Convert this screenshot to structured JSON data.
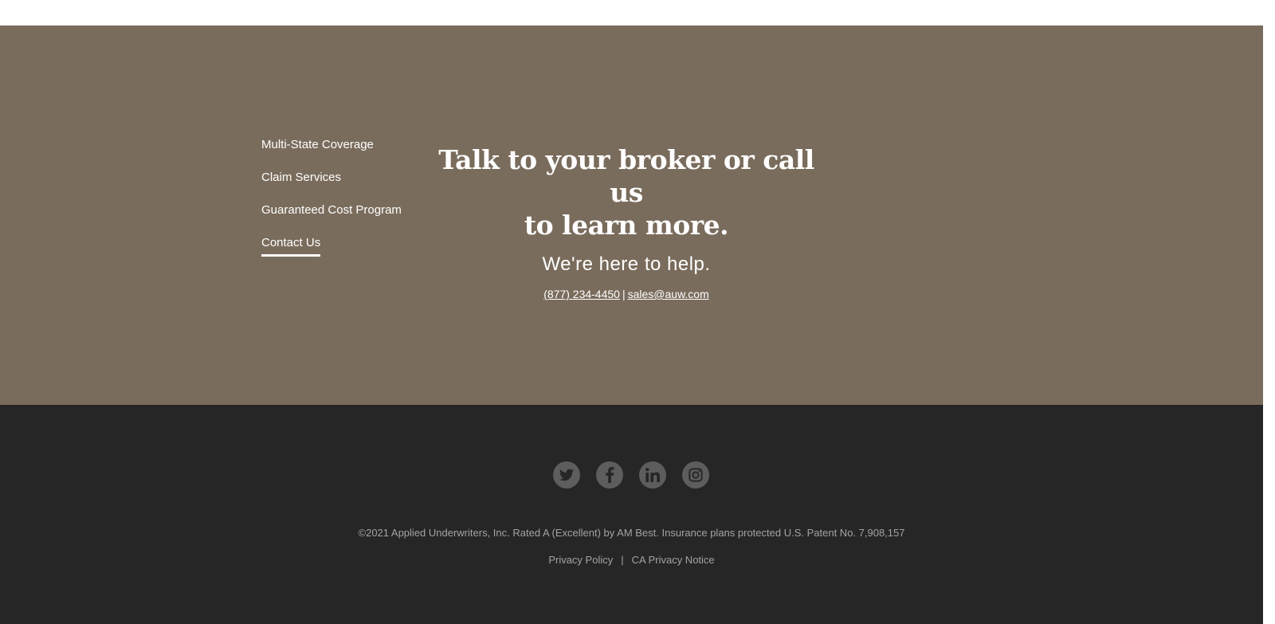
{
  "nav": {
    "items": [
      {
        "label": "Multi-State Coverage"
      },
      {
        "label": "Claim Services"
      },
      {
        "label": "Guaranteed Cost Program"
      },
      {
        "label": "Contact Us",
        "active": true
      }
    ]
  },
  "cta": {
    "headline_line1": "Talk to your broker or call us",
    "headline_line2": "to learn more.",
    "subhead": "We're here to help.",
    "phone": "(877) 234-4450",
    "separator": "|",
    "email": "sales@auw.com"
  },
  "social": {
    "icons": [
      "twitter-icon",
      "facebook-icon",
      "linkedin-icon",
      "instagram-icon"
    ]
  },
  "footer": {
    "copyright": "©2021 Applied Underwriters, Inc. Rated A (Excellent) by AM Best. Insurance plans protected U.S. Patent No. 7,908,157",
    "privacy_policy": "Privacy Policy",
    "separator": "|",
    "ca_privacy_notice": "CA Privacy Notice"
  },
  "colors": {
    "contact_band": "#7a6c5c",
    "footer_band": "#262626",
    "social_circle": "#5d5d5d",
    "footer_text": "#a3a3a3"
  }
}
